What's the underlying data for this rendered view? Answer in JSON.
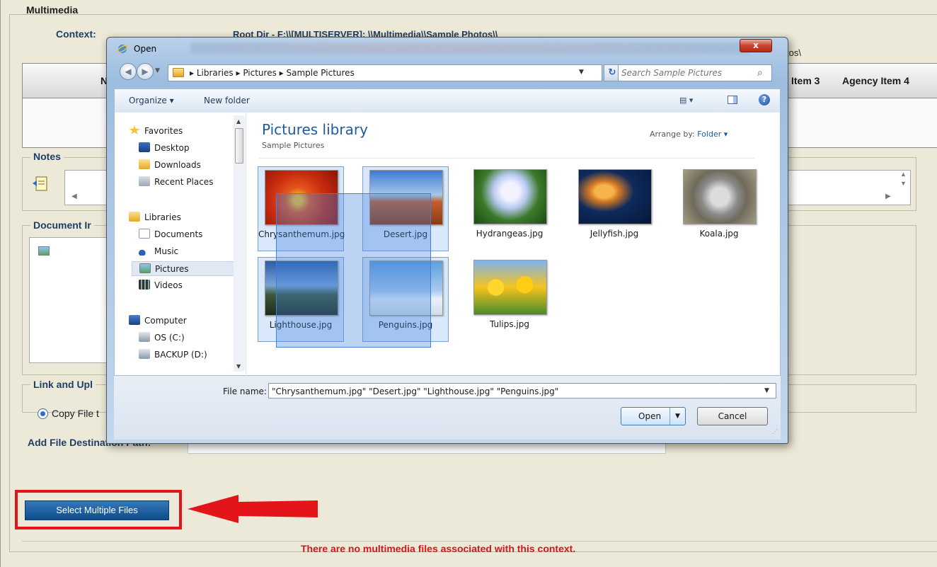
{
  "app": {
    "section_title": "Multimedia",
    "context_label": "Context:",
    "context_value": "Root Dir - F:\\\\[MULTISERVER]:  \\\\Multimedia\\\\Sample Photos\\\\",
    "context_tail": "tos\\",
    "grid_columns": [
      "N",
      "Item 3",
      "Agency Item 4"
    ],
    "notes_title": "Notes",
    "document_title": "Document Ir",
    "link_title": "Link and Upl",
    "copy_file_label": "Copy File t",
    "add_dest_label": "Add File Destination Path:",
    "select_multiple_label": "Select Multiple Files",
    "no_files_msg": "There are no multimedia files associated with this context.",
    "colors": {
      "accent_red": "#e3141a",
      "button_blue": "#0e4c8c",
      "label_blue": "#1f3d66"
    }
  },
  "dialog": {
    "title": "Open",
    "close_label": "x",
    "address_crumbs": "▸ Libraries ▸ Pictures ▸ Sample Pictures",
    "search_placeholder": "Search Sample Pictures",
    "toolbar": {
      "organize": "Organize ▾",
      "new_folder": "New folder"
    },
    "nav": {
      "favorites": "Favorites",
      "desktop": "Desktop",
      "downloads": "Downloads",
      "recent_places": "Recent Places",
      "libraries": "Libraries",
      "documents": "Documents",
      "music": "Music",
      "pictures": "Pictures",
      "videos": "Videos",
      "computer": "Computer",
      "os_c": "OS (C:)",
      "backup_d": "BACKUP (D:)"
    },
    "library_title": "Pictures library",
    "library_sub": "Sample Pictures",
    "arrange_label": "Arrange by:",
    "arrange_value": "Folder ▾",
    "files": [
      {
        "name": "Chrysanthemum.jpg",
        "selected": true
      },
      {
        "name": "Desert.jpg",
        "selected": true
      },
      {
        "name": "Hydrangeas.jpg",
        "selected": false
      },
      {
        "name": "Jellyfish.jpg",
        "selected": false
      },
      {
        "name": "Koala.jpg",
        "selected": false
      },
      {
        "name": "Lighthouse.jpg",
        "selected": true
      },
      {
        "name": "Penguins.jpg",
        "selected": true
      },
      {
        "name": "Tulips.jpg",
        "selected": false
      }
    ],
    "file_name_label": "File name:",
    "file_name_value": "\"Chrysanthemum.jpg\" \"Desert.jpg\" \"Lighthouse.jpg\" \"Penguins.jpg\"",
    "open_label": "Open",
    "cancel_label": "Cancel"
  }
}
